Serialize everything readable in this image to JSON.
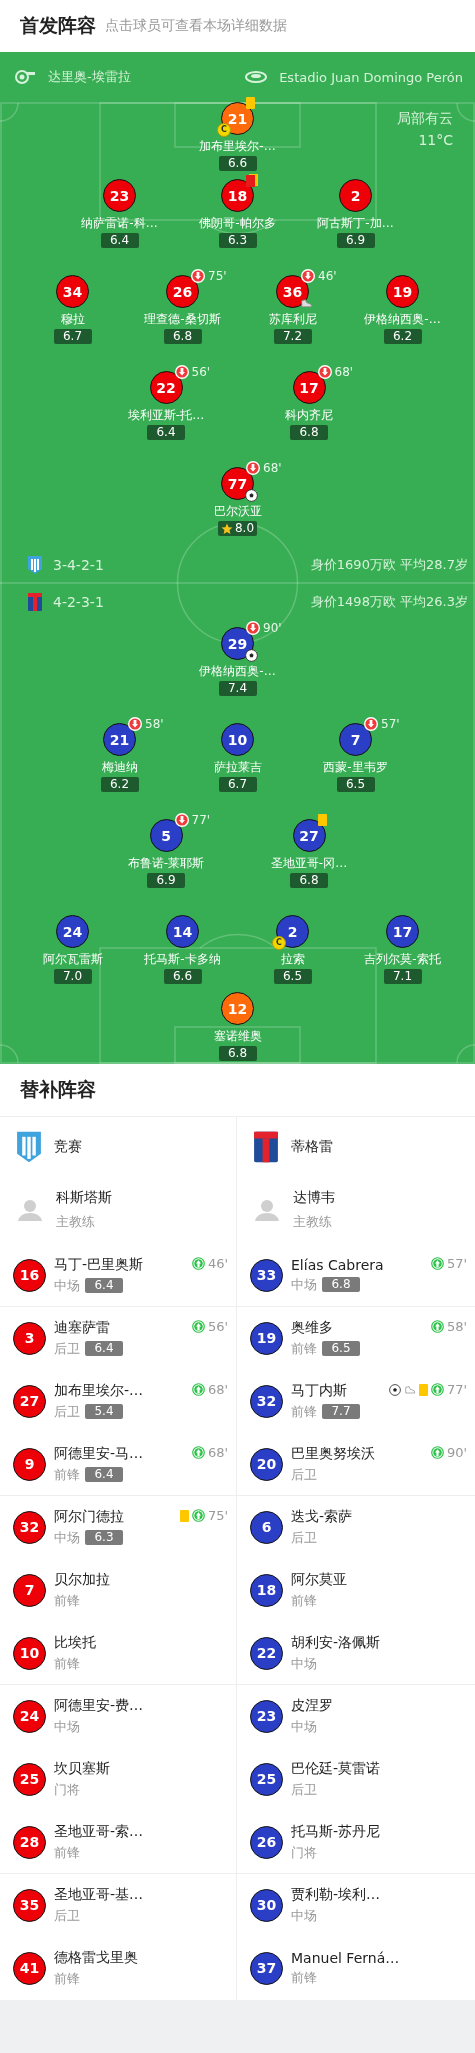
{
  "header": {
    "title": "首发阵容",
    "subtitle": "点击球员可查看本场详细数据"
  },
  "pitch": {
    "referee": "达里奥-埃雷拉",
    "stadium": "Estadio Juan Domingo Perón",
    "weather": "局部有云",
    "temperature": "11°C",
    "home": {
      "formation": "3-4-2-1",
      "value": "身价1690万欧 平均28.7岁",
      "rows": [
        [
          {
            "number": "21",
            "name": "加布里埃尔-…",
            "rating": "6.6",
            "color": "#ff6a0a",
            "badges": [
              {
                "kind": "captain",
                "label": "C"
              },
              {
                "kind": "yellow_card"
              }
            ]
          }
        ],
        [
          {
            "number": "23",
            "name": "纳萨雷诺-科…",
            "rating": "6.4",
            "color": "#ee0008"
          },
          {
            "number": "18",
            "name": "佛朗哥-帕尔多",
            "rating": "6.3",
            "color": "#ee0008",
            "badges": [
              {
                "kind": "second_yellow"
              }
            ]
          },
          {
            "number": "2",
            "name": "阿古斯丁-加…",
            "rating": "6.9",
            "color": "#ee0008"
          }
        ],
        [
          {
            "number": "34",
            "name": "穆拉",
            "rating": "6.7",
            "color": "#ee0008"
          },
          {
            "number": "26",
            "name": "理查德-桑切斯",
            "rating": "6.8",
            "color": "#ee0008",
            "badges": [
              {
                "kind": "sub_off",
                "minute": "75'"
              }
            ]
          },
          {
            "number": "36",
            "name": "苏库利尼",
            "rating": "7.2",
            "color": "#ee0008",
            "badges": [
              {
                "kind": "sub_off",
                "minute": "46'"
              },
              {
                "kind": "assist"
              }
            ]
          },
          {
            "number": "19",
            "name": "伊格纳西奥-…",
            "rating": "6.2",
            "color": "#ee0008"
          }
        ],
        [
          {
            "number": "22",
            "name": "埃利亚斯-托…",
            "rating": "6.4",
            "color": "#ee0008",
            "badges": [
              {
                "kind": "sub_off",
                "minute": "56'"
              }
            ]
          },
          {
            "number": "17",
            "name": "科内齐尼",
            "rating": "6.8",
            "color": "#ee0008",
            "badges": [
              {
                "kind": "sub_off",
                "minute": "68'"
              }
            ]
          }
        ],
        [
          {
            "number": "77",
            "name": "巴尔沃亚",
            "rating": "8.0",
            "color": "#ee0008",
            "badges": [
              {
                "kind": "sub_off",
                "minute": "68'"
              },
              {
                "kind": "goal"
              },
              {
                "kind": "mvp"
              }
            ]
          }
        ]
      ]
    },
    "away": {
      "formation": "4-2-3-1",
      "value": "身价1498万欧 平均26.3岁",
      "rows": [
        [
          {
            "number": "29",
            "name": "伊格纳西奥-…",
            "rating": "7.4",
            "color": "#2b3ec6",
            "badges": [
              {
                "kind": "sub_off",
                "minute": "90'"
              },
              {
                "kind": "goal"
              }
            ]
          }
        ],
        [
          {
            "number": "21",
            "name": "梅迪纳",
            "rating": "6.2",
            "color": "#2b3ec6",
            "badges": [
              {
                "kind": "sub_off",
                "minute": "58'"
              }
            ]
          },
          {
            "number": "10",
            "name": "萨拉莱吉",
            "rating": "6.7",
            "color": "#2b3ec6"
          },
          {
            "number": "7",
            "name": "西蒙-里韦罗",
            "rating": "6.5",
            "color": "#2b3ec6",
            "badges": [
              {
                "kind": "sub_off",
                "minute": "57'"
              }
            ]
          }
        ],
        [
          {
            "number": "5",
            "name": "布鲁诺-莱耶斯",
            "rating": "6.9",
            "color": "#2b3ec6",
            "badges": [
              {
                "kind": "sub_off",
                "minute": "77'"
              }
            ]
          },
          {
            "number": "27",
            "name": "圣地亚哥-冈…",
            "rating": "6.8",
            "color": "#2b3ec6",
            "badges": [
              {
                "kind": "yellow_card"
              }
            ]
          }
        ],
        [
          {
            "number": "24",
            "name": "阿尔瓦雷斯",
            "rating": "7.0",
            "color": "#2b3ec6"
          },
          {
            "number": "14",
            "name": "托马斯-卡多纳",
            "rating": "6.6",
            "color": "#2b3ec6"
          },
          {
            "number": "2",
            "name": "拉索",
            "rating": "6.5",
            "color": "#2b3ec6",
            "badges": [
              {
                "kind": "captain",
                "label": "C"
              }
            ]
          },
          {
            "number": "17",
            "name": "吉列尔莫-索托",
            "rating": "7.1",
            "color": "#2b3ec6"
          }
        ],
        [
          {
            "number": "12",
            "name": "塞诺维奥",
            "rating": "6.8",
            "color": "#ff6a0a"
          }
        ]
      ]
    }
  },
  "subs": {
    "title": "替补阵容",
    "teams": [
      {
        "name": "竞赛",
        "color": "#ee0008",
        "coach": "科斯塔斯",
        "coach_role": "主教练",
        "players": [
          {
            "number": "16",
            "name": "马丁-巴里奥斯",
            "position": "中场",
            "rating": "6.4",
            "badges": [
              {
                "kind": "sub_on",
                "minute": "46'"
              }
            ]
          },
          {
            "number": "3",
            "name": "迪塞萨雷",
            "position": "后卫",
            "rating": "6.4",
            "badges": [
              {
                "kind": "sub_on",
                "minute": "56'"
              }
            ]
          },
          {
            "number": "27",
            "name": "加布里埃尔-…",
            "position": "后卫",
            "rating": "5.4",
            "badges": [
              {
                "kind": "sub_on",
                "minute": "68'"
              }
            ]
          },
          {
            "number": "9",
            "name": "阿德里安-马…",
            "position": "前锋",
            "rating": "6.4",
            "badges": [
              {
                "kind": "sub_on",
                "minute": "68'"
              }
            ]
          },
          {
            "number": "32",
            "name": "阿尔门德拉",
            "position": "中场",
            "rating": "6.3",
            "badges": [
              {
                "kind": "yellow_card"
              },
              {
                "kind": "sub_on",
                "minute": "75'"
              }
            ]
          },
          {
            "number": "7",
            "name": "贝尔加拉",
            "position": "前锋"
          },
          {
            "number": "10",
            "name": "比埃托",
            "position": "前锋"
          },
          {
            "number": "24",
            "name": "阿德里安-费…",
            "position": "中场"
          },
          {
            "number": "25",
            "name": "坎贝塞斯",
            "position": "门将"
          },
          {
            "number": "28",
            "name": "圣地亚哥-索…",
            "position": "前锋"
          },
          {
            "number": "35",
            "name": "圣地亚哥-基…",
            "position": "后卫"
          },
          {
            "number": "41",
            "name": "德格雷戈里奥",
            "position": "前锋"
          }
        ]
      },
      {
        "name": "蒂格雷",
        "color": "#2b3ec6",
        "coach": "达博韦",
        "coach_role": "主教练",
        "players": [
          {
            "number": "33",
            "name": "Elías Cabrera",
            "position": "中场",
            "rating": "6.8",
            "badges": [
              {
                "kind": "sub_on",
                "minute": "57'"
              }
            ]
          },
          {
            "number": "19",
            "name": "奥维多",
            "position": "前锋",
            "rating": "6.5",
            "badges": [
              {
                "kind": "sub_on",
                "minute": "58'"
              }
            ]
          },
          {
            "number": "32",
            "name": "马丁内斯",
            "position": "前锋",
            "rating": "7.7",
            "badges": [
              {
                "kind": "goal"
              },
              {
                "kind": "assist"
              },
              {
                "kind": "yellow_card"
              },
              {
                "kind": "sub_on",
                "minute": "77'"
              }
            ]
          },
          {
            "number": "20",
            "name": "巴里奥努埃沃",
            "position": "后卫",
            "badges": [
              {
                "kind": "sub_on",
                "minute": "90'"
              }
            ]
          },
          {
            "number": "6",
            "name": "迭戈-索萨",
            "position": "后卫"
          },
          {
            "number": "18",
            "name": "阿尔莫亚",
            "position": "前锋"
          },
          {
            "number": "22",
            "name": "胡利安-洛佩斯",
            "position": "中场"
          },
          {
            "number": "23",
            "name": "皮涅罗",
            "position": "中场"
          },
          {
            "number": "25",
            "name": "巴伦廷-莫雷诺",
            "position": "后卫"
          },
          {
            "number": "26",
            "name": "托马斯-苏丹尼",
            "position": "门将"
          },
          {
            "number": "30",
            "name": "贾利勒-埃利…",
            "position": "中场"
          },
          {
            "number": "37",
            "name": "Manuel Ferná…",
            "position": "前锋"
          }
        ]
      }
    ]
  }
}
